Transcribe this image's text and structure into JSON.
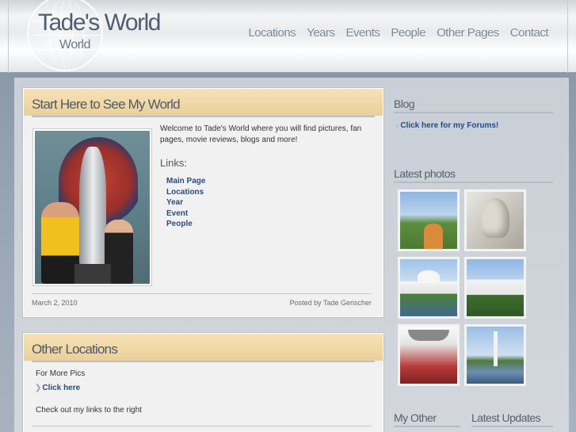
{
  "header": {
    "title": "Tade's World",
    "subtitle": "World",
    "nav": [
      "Locations",
      "Years",
      "Events",
      "People",
      "Other Pages",
      "Contact"
    ]
  },
  "post1": {
    "title": "Start Here to See My World",
    "intro": "Welcome to Tade's World where you will find pictures, fan pages, movie reviews, blogs and more!",
    "links_heading": "Links:",
    "links": [
      "Main Page",
      "Locations",
      "Year",
      "Event",
      "People"
    ],
    "date": "March 2, 2010",
    "posted_by": "Posted by Tade Gerischer"
  },
  "post2": {
    "title": "Other Locations",
    "more_pics": "For More Pics",
    "click_here": "Click here",
    "check_out": "Check out my links to the right"
  },
  "sidebar": {
    "blog_heading": "Blog",
    "blog_link": "Click here for my Forums!",
    "photos_heading": "Latest photos",
    "other_pages_heading": "My Other",
    "latest_updates_heading": "Latest Updates"
  },
  "colors": {
    "accent_link": "#1f4c88",
    "title_bar": "#f0d7a4",
    "heading_text": "#4e5968"
  }
}
